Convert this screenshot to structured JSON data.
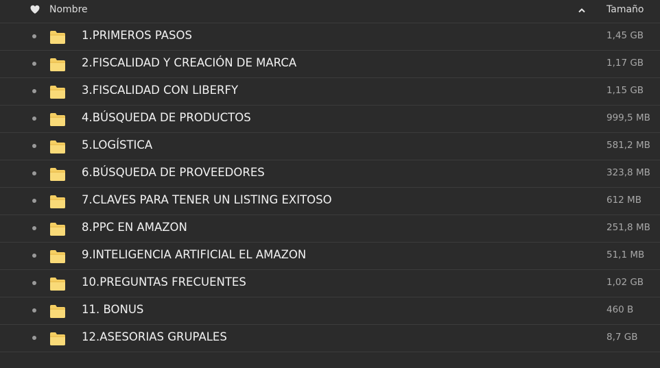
{
  "header": {
    "name_label": "Nombre",
    "size_label": "Tamaño",
    "favorite_icon": "heart-icon",
    "sort_icon": "chevron-up-icon"
  },
  "colors": {
    "background": "#2b2b2b",
    "divider": "#3c3c3c",
    "folder": "#f5cf63",
    "text": "#f2f2f2",
    "muted": "#a8a8a8"
  },
  "files": [
    {
      "name": "1.PRIMEROS PASOS",
      "size": "1,45 GB"
    },
    {
      "name": "2.FISCALIDAD Y CREACIÓN DE MARCA",
      "size": "1,17 GB"
    },
    {
      "name": "3.FISCALIDAD CON LIBERFY",
      "size": "1,15 GB"
    },
    {
      "name": "4.BÚSQUEDA DE PRODUCTOS",
      "size": "999,5 MB"
    },
    {
      "name": "5.LOGÍSTICA",
      "size": "581,2 MB"
    },
    {
      "name": "6.BÚSQUEDA DE PROVEEDORES",
      "size": "323,8 MB"
    },
    {
      "name": "7.CLAVES PARA TENER UN LISTING EXITOSO",
      "size": "612 MB"
    },
    {
      "name": "8.PPC EN AMAZON",
      "size": "251,8 MB"
    },
    {
      "name": "9.INTELIGENCIA ARTIFICIAL EL AMAZON",
      "size": "51,1 MB"
    },
    {
      "name": "10.PREGUNTAS FRECUENTES",
      "size": "1,02 GB"
    },
    {
      "name": "11. BONUS",
      "size": "460 B"
    },
    {
      "name": "12.ASESORIAS GRUPALES",
      "size": "8,7 GB"
    }
  ]
}
